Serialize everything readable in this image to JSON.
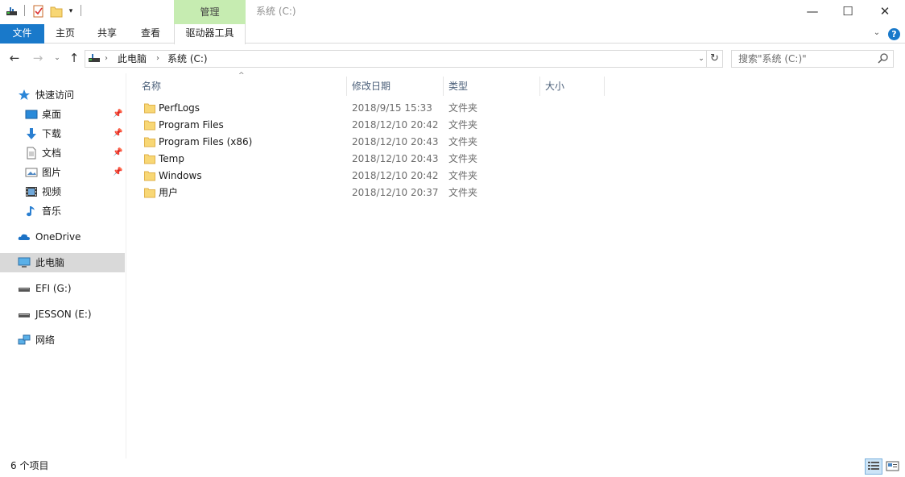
{
  "window": {
    "title": "系统 (C:)",
    "contextual_group": "管理",
    "min_glyph": "—",
    "max_glyph": "☐",
    "close_glyph": "✕"
  },
  "quick_access_toolbar": {
    "dropdown_glyph": "▾"
  },
  "ribbon": {
    "tabs": [
      "文件",
      "主页",
      "共享",
      "查看",
      "驱动器工具"
    ],
    "expand_glyph": "⌄",
    "help_glyph": "?"
  },
  "address": {
    "back_glyph": "←",
    "forward_glyph": "→",
    "recent_glyph": "⌄",
    "up_glyph": "↑",
    "separator_glyph": "›",
    "crumbs": [
      "此电脑",
      "系统 (C:)"
    ],
    "dropdown_glyph": "⌄",
    "refresh_glyph": "↻"
  },
  "search": {
    "placeholder": "搜索\"系统 (C:)\""
  },
  "navigation": {
    "quick_access": "快速访问",
    "pin_glyph": "📌",
    "pinned": [
      {
        "label": "桌面",
        "icon": "desktop-icon",
        "pinned": true
      },
      {
        "label": "下载",
        "icon": "download-icon",
        "pinned": true
      },
      {
        "label": "文档",
        "icon": "documents-icon",
        "pinned": true
      },
      {
        "label": "图片",
        "icon": "pictures-icon",
        "pinned": true
      },
      {
        "label": "视频",
        "icon": "videos-icon",
        "pinned": false
      },
      {
        "label": "音乐",
        "icon": "music-icon",
        "pinned": false
      }
    ],
    "onedrive": "OneDrive",
    "this_pc": "此电脑",
    "drive_g": "EFI (G:)",
    "drive_e": "JESSON (E:)",
    "network": "网络"
  },
  "columns": {
    "name": "名称",
    "date": "修改日期",
    "type": "类型",
    "size": "大小",
    "sort_glyph": "^"
  },
  "files": [
    {
      "name": "PerfLogs",
      "modified": "2018/9/15 15:33",
      "type": "文件夹"
    },
    {
      "name": "Program Files",
      "modified": "2018/12/10 20:42",
      "type": "文件夹"
    },
    {
      "name": "Program Files (x86)",
      "modified": "2018/12/10 20:43",
      "type": "文件夹"
    },
    {
      "name": "Temp",
      "modified": "2018/12/10 20:43",
      "type": "文件夹"
    },
    {
      "name": "Windows",
      "modified": "2018/12/10 20:42",
      "type": "文件夹"
    },
    {
      "name": "用户",
      "modified": "2018/12/10 20:37",
      "type": "文件夹"
    }
  ],
  "status": {
    "item_count": "6 个项目"
  },
  "colors": {
    "accent": "#1979ca",
    "manage_group": "#c6ecb1",
    "folder": "#f8d775",
    "selected_nav": "#d9d9d9"
  }
}
